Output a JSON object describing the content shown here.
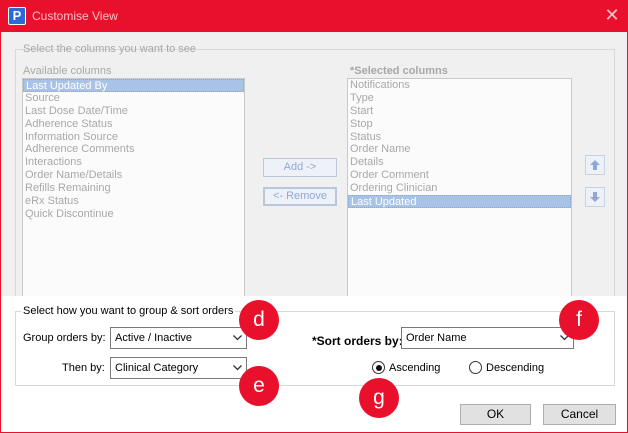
{
  "window": {
    "app_icon_letter": "P",
    "title": "Customise View",
    "close_glyph": "✕",
    "accent_color": "#e8102a"
  },
  "columns": {
    "section_label": "Select the columns you want to see",
    "available_label": "Available columns",
    "selected_label": "*Selected columns",
    "available": [
      "Last Updated By",
      "Source",
      "Last Dose Date/Time",
      "Adherence Status",
      "Information Source",
      "Adherence Comments",
      "Interactions",
      "Order Name/Details",
      "Refills Remaining",
      "eRx Status",
      "Quick Discontinue"
    ],
    "available_selected_index": 0,
    "selected": [
      "Notifications",
      "Type",
      "Start",
      "Stop",
      "Status",
      "Order Name",
      "Details",
      "Order Comment",
      "Ordering Clinician",
      "Last Updated"
    ],
    "selected_selected_index": 9,
    "add_label": "Add ->",
    "remove_label": "<- Remove",
    "move_up_icon": "arrow-up-icon",
    "move_down_icon": "arrow-down-icon"
  },
  "grouping": {
    "section_label": "Select how you want to group & sort orders",
    "group_by_label": "Group orders by:",
    "group_by_value": "Active / Inactive",
    "then_by_label": "Then by:",
    "then_by_value": "Clinical Category",
    "sort_by_label": "*Sort orders by:",
    "sort_by_value": "Order Name",
    "ascending_label": "Ascending",
    "descending_label": "Descending",
    "sort_direction": "Ascending"
  },
  "badges": {
    "d": "d",
    "e": "e",
    "f": "f",
    "g": "g"
  },
  "buttons": {
    "ok": "OK",
    "cancel": "Cancel"
  }
}
